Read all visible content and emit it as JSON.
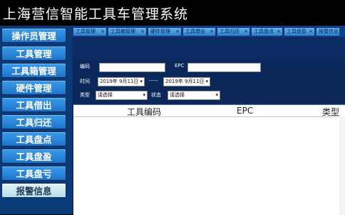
{
  "app": {
    "title": "上海营信智能工具车管理系统"
  },
  "sidebar": {
    "items": [
      {
        "label": "操作员管理"
      },
      {
        "label": "工具管理"
      },
      {
        "label": "工具箱管理"
      },
      {
        "label": "硬件管理"
      },
      {
        "label": "工具借出"
      },
      {
        "label": "工具归还"
      },
      {
        "label": "工具盘点"
      },
      {
        "label": "工具盘盈"
      },
      {
        "label": "工具盘亏"
      },
      {
        "label": "报警信息",
        "selected": true
      }
    ]
  },
  "tabs": [
    {
      "label": "工具管理"
    },
    {
      "label": "工具箱管理"
    },
    {
      "label": "硬件管理"
    },
    {
      "label": "工具借出"
    },
    {
      "label": "工具归还"
    },
    {
      "label": "工具盘点"
    },
    {
      "label": "工具盘盈"
    },
    {
      "label": "报警信息"
    }
  ],
  "tab_close_glyph": "×",
  "filter": {
    "code_label": "编码",
    "code_value": "",
    "epc_label": "EPC",
    "epc_value": "",
    "time_label": "时间",
    "date_from": "2019年 9月11日",
    "date_sep": "-----",
    "date_to": "2019年 9月11日",
    "type_label": "类型",
    "type_value": "请选择",
    "status_label": "状态",
    "status_value": "请选择"
  },
  "table": {
    "columns": [
      "工具编码",
      "EPC",
      "类型"
    ],
    "rows": []
  },
  "colors": {
    "sidebar_bg": "#0b3a78",
    "nav_button": "#2a86d8",
    "nav_selected": "#cdeaf0",
    "main_bg": "#0d2c66"
  }
}
